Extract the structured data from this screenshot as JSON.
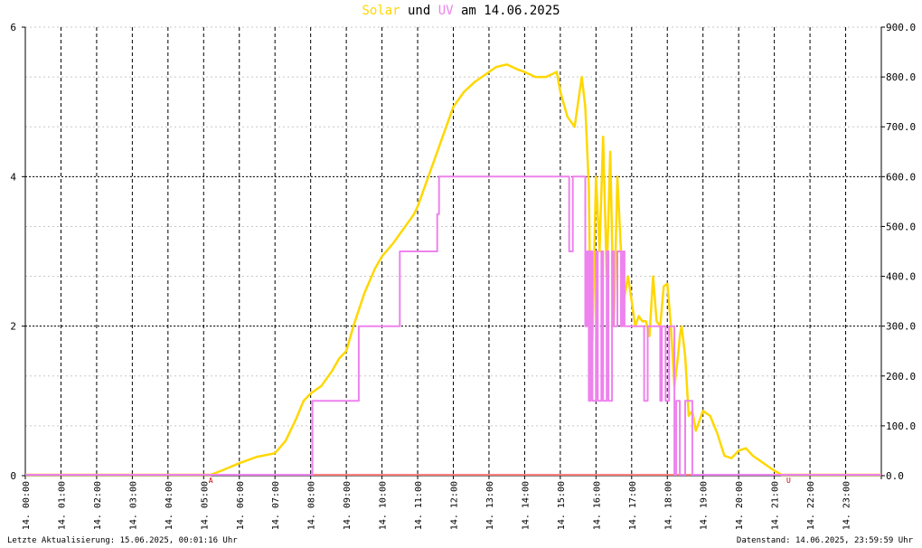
{
  "title": {
    "series1": "Solar",
    "mid": " und ",
    "series2": "UV",
    "rest": " am 14.06.2025"
  },
  "footer": {
    "left": "Letzte Aktualisierung: 15.06.2025, 00:01:16 Uhr",
    "right": "Datenstand: 14.06.2025, 23:59:59 Uhr"
  },
  "markers": {
    "sunrise": "A",
    "sunset": "U"
  },
  "colors": {
    "solar": "#ffd700",
    "uv": "#ee82ee",
    "baseline": "#ff7f7f",
    "grid": "#000000",
    "minor_grid": "#c8c8c8",
    "marker": "#cc0000"
  },
  "chart_data": {
    "type": "line",
    "title": "Solar und UV am 14.06.2025",
    "x_tick_labels": [
      "14. 00:00",
      "14. 01:00",
      "14. 02:00",
      "14. 03:00",
      "14. 04:00",
      "14. 05:00",
      "14. 06:00",
      "14. 07:00",
      "14. 08:00",
      "14. 09:00",
      "14. 10:00",
      "14. 11:00",
      "14. 12:00",
      "14. 13:00",
      "14. 14:00",
      "14. 15:00",
      "14. 16:00",
      "14. 17:00",
      "14. 18:00",
      "14. 19:00",
      "14. 20:00",
      "14. 21:00",
      "14. 22:00",
      "14. 23:00"
    ],
    "xlim_hours": [
      0,
      24
    ],
    "left_axis": {
      "ylim": [
        0,
        6
      ],
      "ticks": [
        0,
        2,
        4,
        6
      ],
      "tick_labels": [
        "0",
        "2",
        "4",
        "6"
      ],
      "series": "UV"
    },
    "right_axis": {
      "ylim": [
        0,
        900
      ],
      "ticks": [
        0,
        100,
        200,
        300,
        400,
        500,
        600,
        700,
        800,
        900
      ],
      "tick_labels": [
        "0.0",
        "100.0",
        "200.0",
        "300.0",
        "400.0",
        "500.0",
        "600.0",
        "700.0",
        "800.0",
        "900.0"
      ],
      "series": "Solar"
    },
    "grid": true,
    "series": [
      {
        "name": "Solar",
        "axis": "right",
        "x": [
          0,
          5.2,
          5.5,
          6,
          6.5,
          7,
          7.3,
          7.6,
          7.8,
          8,
          8.3,
          8.6,
          8.8,
          9,
          9.2,
          9.5,
          9.8,
          10,
          10.3,
          10.6,
          10.9,
          11,
          11.05,
          11.2,
          11.5,
          11.8,
          12,
          12.3,
          12.6,
          13,
          13.2,
          13.5,
          13.8,
          14,
          14.3,
          14.6,
          14.9,
          15,
          15.2,
          15.4,
          15.6,
          15.7,
          15.8,
          15.85,
          15.9,
          16,
          16.1,
          16.2,
          16.3,
          16.4,
          16.5,
          16.6,
          16.7,
          16.8,
          16.9,
          17,
          17.1,
          17.2,
          17.3,
          17.4,
          17.5,
          17.6,
          17.7,
          17.8,
          17.9,
          18,
          18.1,
          18.2,
          18.3,
          18.35,
          18.4,
          18.5,
          18.6,
          18.7,
          18.8,
          19,
          19.2,
          19.4,
          19.6,
          19.8,
          20,
          20.2,
          20.4,
          20.6,
          20.8,
          21,
          21.2,
          21.4,
          21.6,
          24
        ],
        "y": [
          0,
          0,
          10,
          25,
          38,
          45,
          70,
          115,
          150,
          165,
          180,
          210,
          235,
          250,
          300,
          365,
          415,
          440,
          465,
          495,
          525,
          540,
          550,
          580,
          640,
          700,
          740,
          770,
          790,
          810,
          820,
          825,
          815,
          810,
          800,
          800,
          810,
          770,
          720,
          700,
          800,
          740,
          580,
          300,
          270,
          600,
          450,
          680,
          400,
          650,
          300,
          600,
          450,
          360,
          400,
          350,
          300,
          320,
          310,
          310,
          280,
          400,
          310,
          300,
          380,
          385,
          300,
          180,
          240,
          280,
          300,
          240,
          120,
          130,
          90,
          130,
          120,
          85,
          40,
          35,
          50,
          55,
          40,
          30,
          20,
          10,
          0,
          0,
          0,
          0
        ]
      },
      {
        "name": "UV",
        "axis": "left",
        "x": [
          0,
          8.05,
          8.05,
          9.35,
          9.35,
          10.5,
          10.5,
          11.55,
          11.55,
          11.6,
          11.6,
          15.25,
          15.25,
          15.35,
          15.35,
          15.7,
          15.7,
          15.75,
          15.75,
          15.8,
          15.8,
          15.85,
          15.85,
          15.9,
          15.9,
          16,
          16,
          16.05,
          16.05,
          16.15,
          16.15,
          16.2,
          16.2,
          16.3,
          16.3,
          16.35,
          16.35,
          16.45,
          16.45,
          16.5,
          16.5,
          16.6,
          16.6,
          16.7,
          16.7,
          16.75,
          16.75,
          16.8,
          16.8,
          16.9,
          16.9,
          17.35,
          17.35,
          17.45,
          17.45,
          17.8,
          17.8,
          17.85,
          17.85,
          17.95,
          17.95,
          18.05,
          18.05,
          18.2,
          18.2,
          18.25,
          18.25,
          18.35,
          18.35,
          18.5,
          18.5,
          18.7,
          18.7,
          24
        ],
        "y": [
          0,
          0,
          1,
          1,
          2,
          2,
          3,
          3,
          3.5,
          3.5,
          4,
          4,
          3,
          3,
          4,
          4,
          2,
          2,
          3,
          3,
          1,
          1,
          3,
          3,
          1,
          1,
          3,
          3,
          1,
          1,
          3,
          3,
          1,
          1,
          3,
          3,
          1,
          1,
          3,
          3,
          2,
          2,
          3,
          3,
          2,
          2,
          3,
          3,
          2,
          2,
          2,
          2,
          1,
          1,
          2,
          2,
          1,
          1,
          2,
          2,
          1,
          1,
          2,
          2,
          0,
          0,
          1,
          1,
          0,
          0,
          1,
          1,
          0,
          0
        ]
      }
    ]
  }
}
